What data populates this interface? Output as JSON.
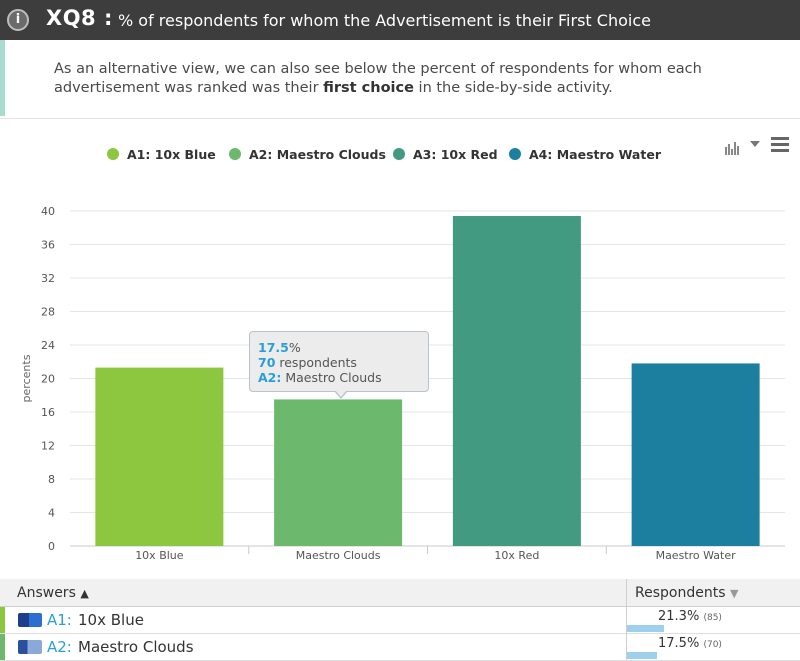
{
  "header": {
    "code": "XQ8 :",
    "title": "% of respondents for whom the Advertisement is their First Choice",
    "info_icon_text": "i"
  },
  "intro": {
    "text_before": "As an alternative view, we can also see below the percent of respondents for whom each advertisement was ranked was their ",
    "bold": "first choice",
    "text_after": " in the side-by-side activity."
  },
  "chart_data": {
    "type": "bar",
    "categories": [
      "10x Blue",
      "Maestro Clouds",
      "10x Red",
      "Maestro Water"
    ],
    "series": [
      {
        "name": "A1: 10x Blue",
        "category": "10x Blue",
        "value": 21.3,
        "color": "#8dc63f"
      },
      {
        "name": "A2: Maestro Clouds",
        "category": "Maestro Clouds",
        "value": 17.5,
        "color": "#6cb86c"
      },
      {
        "name": "A3: 10x Red",
        "category": "10x Red",
        "value": 39.4,
        "color": "#429a80"
      },
      {
        "name": "A4: Maestro Water",
        "category": "Maestro Water",
        "value": 21.8,
        "color": "#1d7fa0"
      }
    ],
    "ylabel": "percents",
    "xlabel": "",
    "ylim": [
      0,
      40
    ],
    "yticks": [
      0,
      4,
      8,
      12,
      16,
      20,
      24,
      28,
      32,
      36,
      40
    ],
    "grid": true,
    "legend_position": "top"
  },
  "tooltip": {
    "value": "17.5",
    "value_unit": "%",
    "respondents_count": "70",
    "respondents_label": " respondents",
    "series_code": "A2:",
    "series_label": " Maestro Clouds"
  },
  "table": {
    "col_answers": "Answers",
    "col_answers_sort": "▲",
    "col_respondents": "Respondents",
    "col_respondents_sort": "▼",
    "rows": [
      {
        "code": "A1:",
        "label": "10x Blue",
        "percent": "21.3%",
        "count": "(85)",
        "fraction": 0.213,
        "accent": "#8dc63f"
      },
      {
        "code": "A2:",
        "label": "Maestro Clouds",
        "percent": "17.5%",
        "count": "(70)",
        "fraction": 0.175,
        "accent": "#6cb86c"
      }
    ]
  }
}
